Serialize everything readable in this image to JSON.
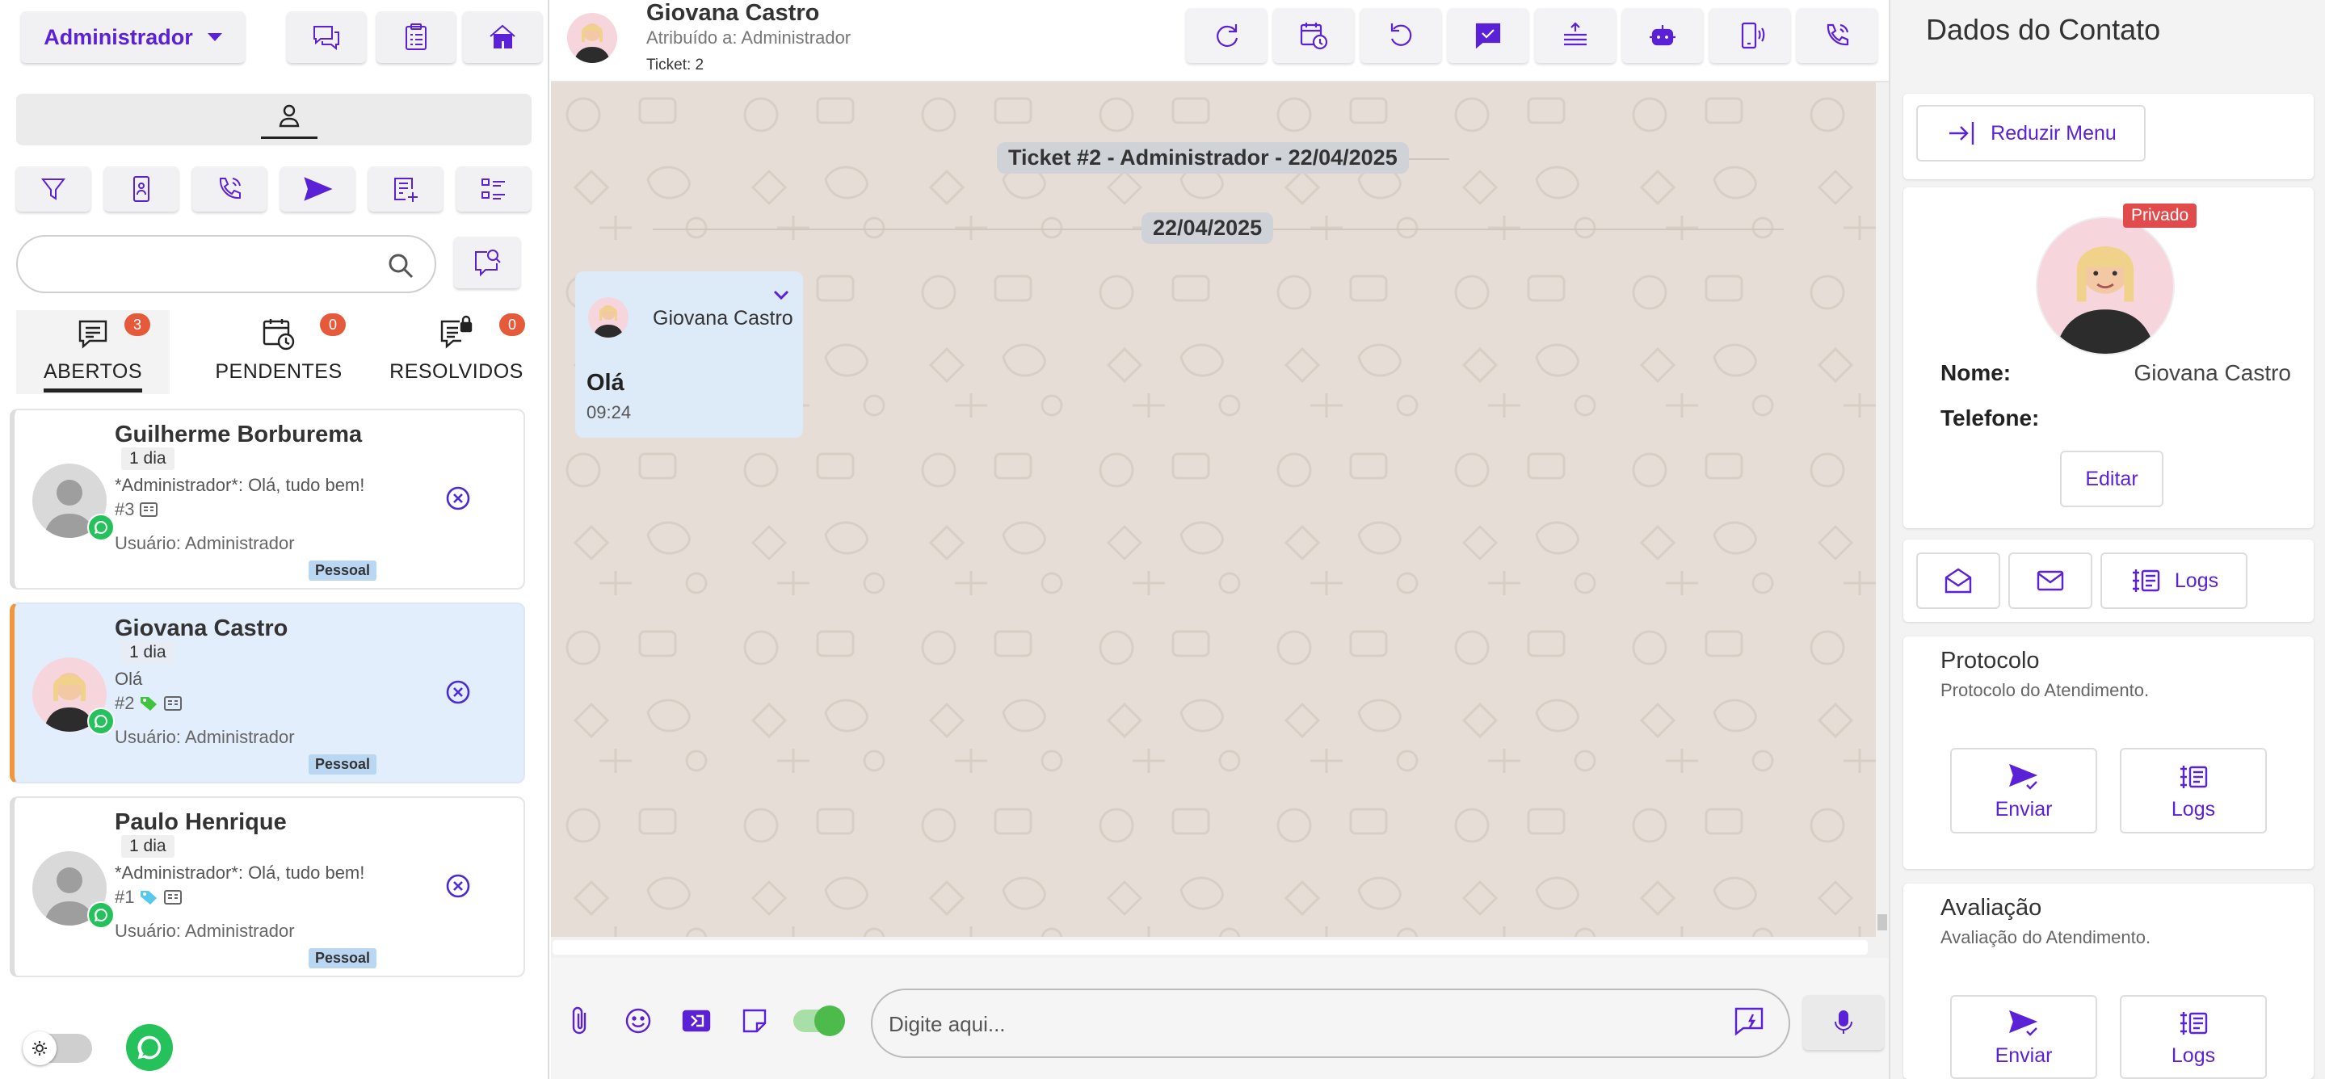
{
  "left": {
    "user_menu": "Administrador",
    "search_placeholder": "",
    "tabs": [
      {
        "label": "ABERTOS",
        "count": "3"
      },
      {
        "label": "PENDENTES",
        "count": "0"
      },
      {
        "label": "RESOLVIDOS",
        "count": "0"
      }
    ],
    "tickets": [
      {
        "name": "Guilherme Borburema",
        "age": "1 dia",
        "message": "*Administrador*: Olá, tudo bem!",
        "number": "#3",
        "user": "Usuário: Administrador",
        "tag": "Pessoal"
      },
      {
        "name": "Giovana Castro",
        "age": "1 dia",
        "message": "Olá",
        "number": "#2",
        "user": "Usuário: Administrador",
        "tag": "Pessoal"
      },
      {
        "name": "Paulo Henrique",
        "age": "1 dia",
        "message": "*Administrador*: Olá, tudo bem!",
        "number": "#1",
        "user": "Usuário: Administrador",
        "tag": "Pessoal"
      }
    ]
  },
  "chat": {
    "contact_name": "Giovana Castro",
    "assigned": "Atribuído a: Administrador",
    "ticket": "Ticket: 2",
    "ticket_divider": "Ticket #2 - Administrador - 22/04/2025",
    "date_divider": "22/04/2025",
    "message": {
      "sender": "Giovana Castro",
      "text": "Olá",
      "time": "09:24"
    },
    "input_placeholder": "Digite aqui..."
  },
  "contact": {
    "title": "Dados do Contato",
    "reduce_menu": "Reduzir Menu",
    "privacy_badge": "Privado",
    "name_label": "Nome:",
    "name_value": "Giovana Castro",
    "phone_label": "Telefone:",
    "phone_value": "",
    "edit_label": "Editar",
    "logs_label": "Logs",
    "protocol": {
      "title": "Protocolo",
      "subtitle": "Protocolo do Atendimento.",
      "send": "Enviar",
      "logs": "Logs"
    },
    "rating": {
      "title": "Avaliação",
      "subtitle": "Avaliação do Atendimento.",
      "send": "Enviar",
      "logs": "Logs"
    }
  },
  "colors": {
    "accent": "#5b21d6",
    "selected_ticket": "#e3eefc",
    "badge": "#e45a3a",
    "whatsapp": "#25c15b",
    "chat_bg": "#e6ded6"
  }
}
